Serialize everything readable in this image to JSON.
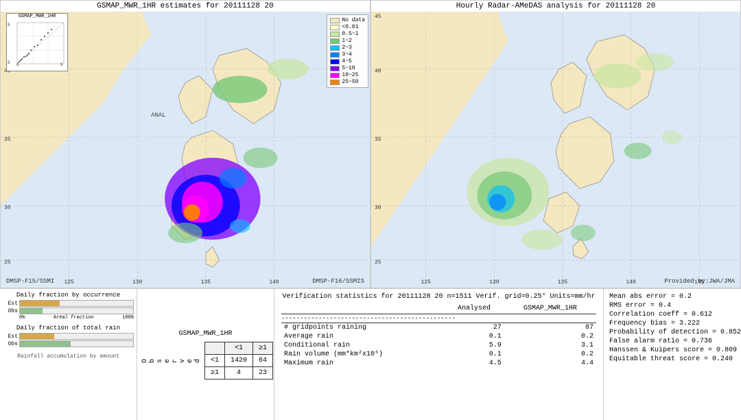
{
  "left_map": {
    "title": "GSMAP_MWR_1HR estimates for 20111128 20",
    "bottom_label": "DMSP-F16/SSMIS",
    "bottom_left_label": "DMSP-F15/SSMI",
    "anal_label": "ANAL"
  },
  "right_map": {
    "title": "Hourly Radar-AMeDAS analysis for 20111128 20",
    "bottom_label": "Provided by:JWA/JMA"
  },
  "legend": {
    "title": "",
    "items": [
      {
        "label": "No data",
        "color": "#f5e8c0"
      },
      {
        "label": "<0.01",
        "color": "#ffffcc"
      },
      {
        "label": "0.5~1",
        "color": "#c8e6a0"
      },
      {
        "label": "1~2",
        "color": "#78c878"
      },
      {
        "label": "2~3",
        "color": "#00bfff"
      },
      {
        "label": "3~4",
        "color": "#0080ff"
      },
      {
        "label": "4~5",
        "color": "#0000ff"
      },
      {
        "label": "5~10",
        "color": "#8000ff"
      },
      {
        "label": "10~25",
        "color": "#ff00ff"
      },
      {
        "label": "25~50",
        "color": "#ff8000"
      }
    ]
  },
  "bar_charts": {
    "section1_title": "Daily fraction by occurrence",
    "est_label": "Est",
    "obs_label": "Obs",
    "axis_left": "0%",
    "axis_right": "100%",
    "axis_mid": "Areal fraction",
    "section2_title": "Daily fraction of total rain",
    "section3_title": "Rainfall accumulation by amount",
    "est_bar1_width": 35,
    "obs_bar1_width": 20,
    "est_bar2_width": 30,
    "obs_bar2_width": 45
  },
  "contingency": {
    "title": "GSMAP_MWR_1HR",
    "col_header1": "<1",
    "col_header2": "≥1",
    "row_header1": "<1",
    "row_header2": "≥1",
    "obs_label": "O\nb\ns\ne\nr\nv\ne\nd",
    "val_lt1_lt1": "1420",
    "val_lt1_ge1": "64",
    "val_ge1_lt1": "4",
    "val_ge1_ge1": "23"
  },
  "verification": {
    "title": "Verification statistics for 20111128 20  n=1511  Verif. grid=0.25°  Units=mm/hr",
    "col_analysed": "Analysed",
    "col_gsmap": "GSMAP_MWR_1HR",
    "divider": "-----------------------------------------------",
    "rows": [
      {
        "label": "# gridpoints raining",
        "analysed": "27",
        "gsmap": "87"
      },
      {
        "label": "Average rain",
        "analysed": "0.1",
        "gsmap": "0.2"
      },
      {
        "label": "Conditional rain",
        "analysed": "5.9",
        "gsmap": "3.1"
      },
      {
        "label": "Rain volume (mm*km²x10⁶)",
        "analysed": "0.1",
        "gsmap": "0.2"
      },
      {
        "label": "Maximum rain",
        "analysed": "4.5",
        "gsmap": "4.4"
      }
    ]
  },
  "right_stats": {
    "mean_abs_error": "Mean abs error = 0.2",
    "rms_error": "RMS error = 0.4",
    "correlation": "Correlation coeff = 0.612",
    "freq_bias": "Frequency bias = 3.222",
    "prob_detection": "Probability of detection = 0.852",
    "false_alarm": "False alarm ratio = 0.736",
    "hanssen": "Hanssen & Kuipers score = 0.809",
    "equitable": "Equitable threat score = 0.240"
  }
}
